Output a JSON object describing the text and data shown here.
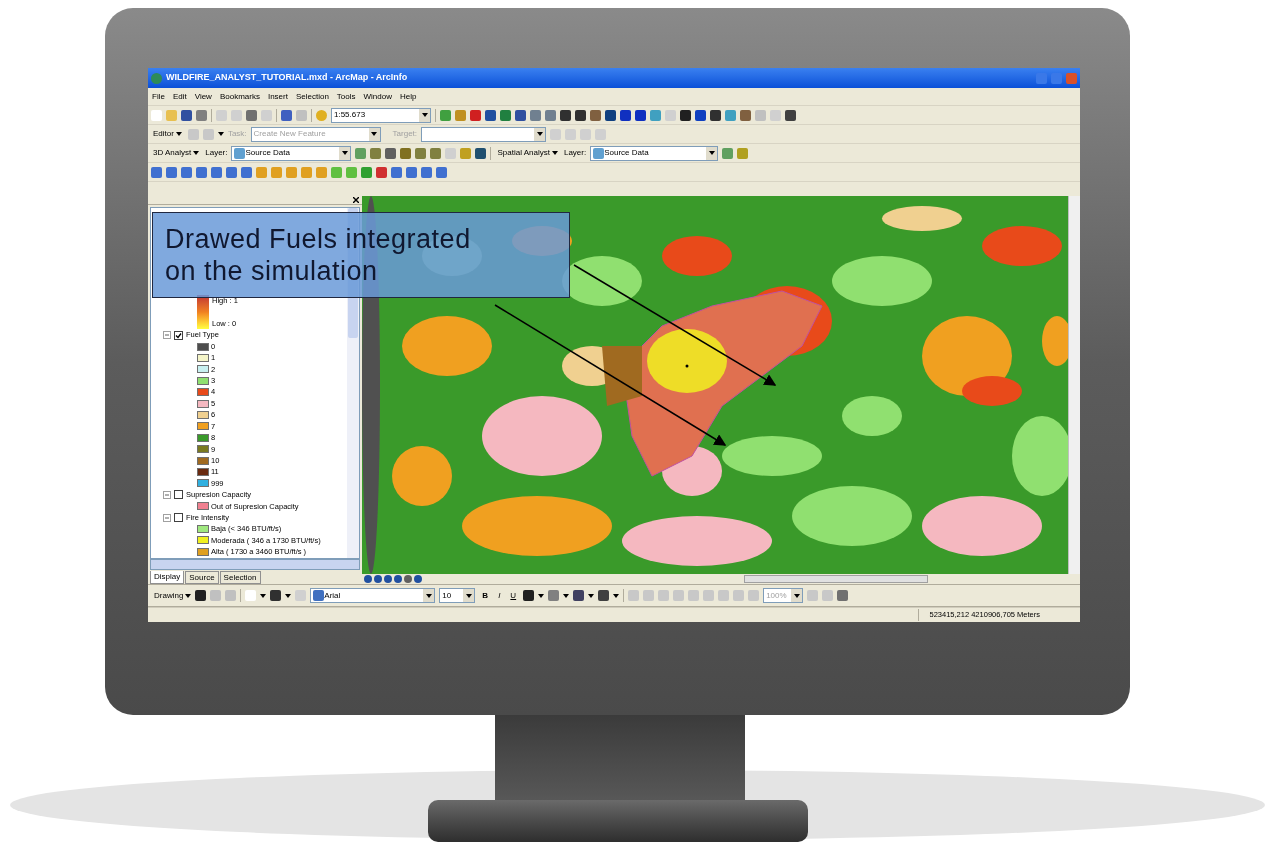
{
  "window": {
    "title": "WILDFIRE_ANALYST_TUTORIAL.mxd - ArcMap - ArcInfo"
  },
  "menu": [
    "File",
    "Edit",
    "View",
    "Bookmarks",
    "Insert",
    "Selection",
    "Tools",
    "Window",
    "Help"
  ],
  "standard_toolbar": {
    "scale": "1:55.673"
  },
  "editor_toolbar": {
    "editor_menu": "Editor",
    "task_label": "Task:",
    "task_value": "Create New Feature",
    "target_label": "Target:",
    "disabled": true
  },
  "analyst_toolbars": [
    {
      "menu": "3D Analyst",
      "layer_label": "Layer:",
      "layer_value": "Source Data"
    },
    {
      "menu": "Spatial Analyst",
      "layer_label": "Layer:",
      "layer_value": "Source Data"
    }
  ],
  "table_of_contents": {
    "items": [
      {
        "kind": "ramp",
        "high": "High : 1",
        "low": "Low : 0"
      },
      {
        "kind": "layer",
        "name": "Fuel Type",
        "checked": true,
        "expanded": true,
        "children": [
          {
            "label": "0",
            "color": "#4d4d4d"
          },
          {
            "label": "1",
            "color": "#f5f5c8"
          },
          {
            "label": "2",
            "color": "#c8f0f0"
          },
          {
            "label": "3",
            "color": "#90e070"
          },
          {
            "label": "4",
            "color": "#e84a1a"
          },
          {
            "label": "5",
            "color": "#f5b8c0"
          },
          {
            "label": "6",
            "color": "#f0d090"
          },
          {
            "label": "7",
            "color": "#f0a020"
          },
          {
            "label": "8",
            "color": "#3a9a2a"
          },
          {
            "label": "9",
            "color": "#7a7a20"
          },
          {
            "label": "10",
            "color": "#a06a20"
          },
          {
            "label": "11",
            "color": "#6a2a10"
          },
          {
            "label": "999",
            "color": "#30b0e0"
          }
        ]
      },
      {
        "kind": "layer",
        "name": "Supresion Capacity",
        "checked": false,
        "expanded": true,
        "children": [
          {
            "label": "Out of Supresion Capacity",
            "color": "#f08090"
          }
        ]
      },
      {
        "kind": "layer",
        "name": "Fire Intensity",
        "checked": false,
        "expanded": true,
        "children": [
          {
            "label": "Baja (< 346 BTU/ft/s)",
            "color": "#a0e880"
          },
          {
            "label": "Moderada ( 346 a  1730 BTU/ft/s)",
            "color": "#f0f020"
          },
          {
            "label": "Alta ( 1730 a 3460 BTU/ft/s )",
            "color": "#e0a020"
          }
        ]
      }
    ]
  },
  "toc_tabs": [
    {
      "label": "Display",
      "selected": true
    },
    {
      "label": "Source",
      "selected": false
    },
    {
      "label": "Selection",
      "selected": false
    }
  ],
  "drawing_toolbar": {
    "menu": "Drawing",
    "font": "Arial",
    "size": "10",
    "bold": "B",
    "italic": "I",
    "underline": "U",
    "zoom": "100%"
  },
  "status_bar": {
    "coordinates": "523415,212  4210906,705 Meters"
  },
  "callout": {
    "lines": [
      "Drawed Fuels integrated",
      "on the simulation"
    ]
  }
}
